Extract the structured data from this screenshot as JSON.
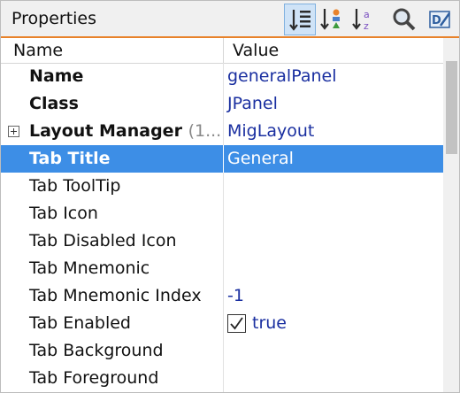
{
  "header": {
    "title": "Properties",
    "toolbar": [
      {
        "icon": "sort-categorized-icon",
        "active": true
      },
      {
        "icon": "sort-by-type-icon",
        "active": false
      },
      {
        "icon": "sort-alphabetical-icon",
        "active": false
      },
      {
        "icon": "search-icon",
        "active": false
      },
      {
        "icon": "customize-properties-icon",
        "active": false
      }
    ]
  },
  "columns": {
    "name": "Name",
    "value": "Value"
  },
  "rows": [
    {
      "name": "Name",
      "value": "generalPanel",
      "bold": true
    },
    {
      "name": "Class",
      "value": "JPanel",
      "bold": true
    },
    {
      "name": "Layout Manager",
      "hint": "(1...",
      "value": "MigLayout",
      "bold": true,
      "expandable": true
    },
    {
      "name": "Tab Title",
      "value": "General",
      "bold": true,
      "selected": true
    },
    {
      "name": "Tab ToolTip",
      "value": ""
    },
    {
      "name": "Tab Icon",
      "value": ""
    },
    {
      "name": "Tab Disabled Icon",
      "value": ""
    },
    {
      "name": "Tab Mnemonic",
      "value": ""
    },
    {
      "name": "Tab Mnemonic Index",
      "value": "-1"
    },
    {
      "name": "Tab Enabled",
      "value": "true",
      "checkbox": true,
      "checked": true
    },
    {
      "name": "Tab Background",
      "value": ""
    },
    {
      "name": "Tab Foreground",
      "value": ""
    }
  ],
  "colors": {
    "accent": "#e8822a",
    "selection": "#3d8ee6",
    "value_text": "#1a2fa0"
  }
}
